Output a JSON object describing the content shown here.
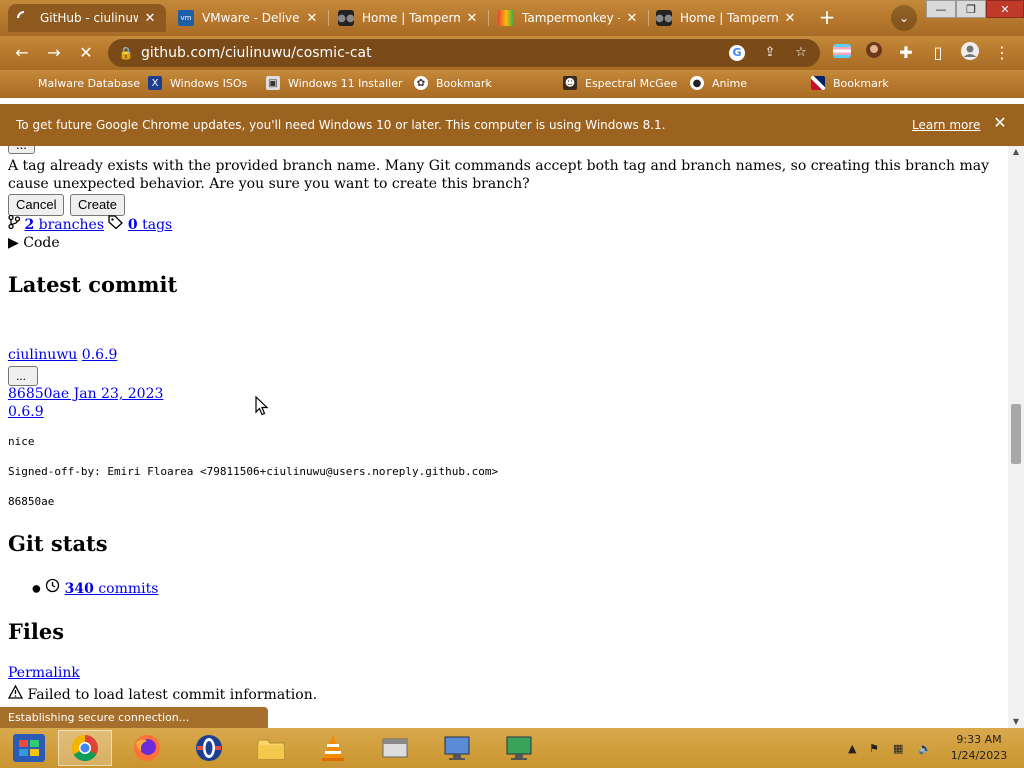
{
  "browser": {
    "tabs": [
      {
        "title": "GitHub - ciulinuwu",
        "active": true
      },
      {
        "title": "VMware - Deliver",
        "active": false
      },
      {
        "title": "Home | Tampermo",
        "active": false
      },
      {
        "title": "Tampermonkey - C",
        "active": false
      },
      {
        "title": "Home | Tamperm",
        "active": false
      }
    ],
    "url": "github.com/ciulinuwu/cosmic-cat",
    "bookmarks": [
      "Malware Database",
      "Windows ISOs",
      "Windows 11 Installer",
      "Bookmark",
      "Espectral McGee",
      "Anime",
      "Bookmark"
    ],
    "infobar": {
      "message": "To get future Google Chrome updates, you'll need Windows 10 or later. This computer is using Windows 8.1.",
      "learn_more": "Learn more"
    },
    "status_text": "Establishing secure connection..."
  },
  "page": {
    "top_button": "...",
    "warning": "A tag already exists with the provided branch name. Many Git commands accept both tag and branch names, so creating this branch may cause unexpected behavior. Are you sure you want to create this branch?",
    "cancel_label": "Cancel",
    "create_label": "Create",
    "branches_count": "2",
    "branches_label": "branches",
    "tags_count": "0",
    "tags_label": "tags",
    "code_label": "Code",
    "latest_commit_heading": "Latest commit",
    "commit_author": "ciulinuwu",
    "commit_version": "0.6.9",
    "expand_button": "...",
    "commit_hash_date": "86850ae Jan 23, 2023",
    "commit_version_link": "0.6.9",
    "commit_message": "nice",
    "signed_off": "Signed-off-by: Emiri Floarea <79811506+ciulinuwu@users.noreply.github.com>",
    "commit_sha": "86850ae",
    "git_stats_heading": "Git stats",
    "commits_count": "340",
    "commits_label": "commits",
    "files_heading": "Files",
    "permalink": "Permalink",
    "failed_load": "Failed to load latest commit information."
  },
  "taskbar": {
    "time": "9:33 AM",
    "date": "1/24/2023"
  },
  "colors": {
    "chrome_theme": "#b87a2e",
    "infobar": "#9c6220",
    "taskbar": "#c9952f",
    "link": "#0000ee"
  }
}
